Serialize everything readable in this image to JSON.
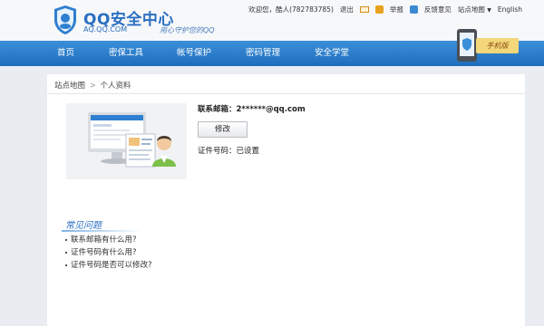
{
  "header": {
    "logo_title": "QQ安全中心",
    "logo_sub": "AQ.QQ.COM",
    "logo_slogan": "用心守护您的QQ",
    "welcome": "欢迎您，酷人(782783785)",
    "logout": "退出",
    "report": "举报",
    "feedback": "反馈意见",
    "sitemap": "站点地图",
    "english": "English"
  },
  "nav": {
    "items": [
      {
        "label": "首页"
      },
      {
        "label": "密保工具"
      },
      {
        "label": "帐号保护"
      },
      {
        "label": "密码管理"
      },
      {
        "label": "安全学堂"
      }
    ],
    "mobile_promo": "手机版"
  },
  "breadcrumb": {
    "root": "站点地图",
    "separator": ">",
    "current": "个人资料"
  },
  "profile": {
    "email_label": "联系邮箱：",
    "email_value": "2******@qq.com",
    "edit_button": "修改",
    "id_label": "证件号码：",
    "id_value": "已设置"
  },
  "faq": {
    "title": "常见问题",
    "items": [
      "联系邮箱有什么用?",
      "证件号码有什么用?",
      "证件号码是否可以修改?"
    ]
  },
  "colors": {
    "brand_blue": "#2a6fc1",
    "nav_top": "#3a8fd9",
    "nav_bottom": "#1f6dbd",
    "page_bg": "#e9edf2"
  }
}
